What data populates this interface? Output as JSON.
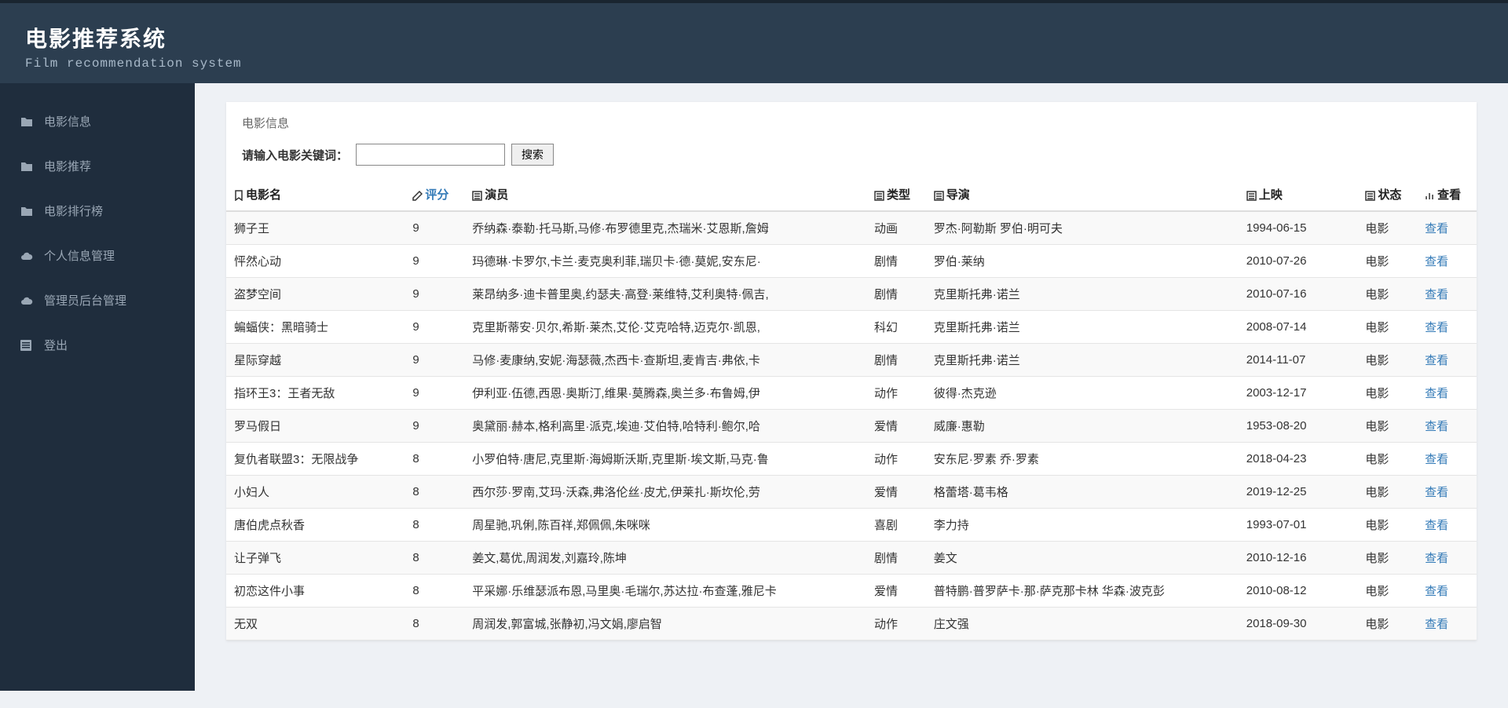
{
  "header": {
    "title": "电影推荐系统",
    "subtitle": "Film recommendation system"
  },
  "sidebar": {
    "items": [
      {
        "label": "电影信息",
        "icon": "folder"
      },
      {
        "label": "电影推荐",
        "icon": "folder"
      },
      {
        "label": "电影排行榜",
        "icon": "folder"
      },
      {
        "label": "个人信息管理",
        "icon": "cloud"
      },
      {
        "label": "管理员后台管理",
        "icon": "cloud"
      },
      {
        "label": "登出",
        "icon": "list"
      }
    ]
  },
  "panel": {
    "title": "电影信息"
  },
  "search": {
    "label": "请输入电影关键词：",
    "value": "",
    "button": "搜索"
  },
  "columns": {
    "name": "电影名",
    "score": "评分",
    "actor": "演员",
    "type": "类型",
    "director": "导演",
    "release": "上映",
    "status": "状态",
    "view": "查看"
  },
  "view_link_text": "查看",
  "rows": [
    {
      "name": "狮子王",
      "score": "9",
      "actor": "乔纳森·泰勒·托马斯,马修·布罗德里克,杰瑞米·艾恩斯,詹姆",
      "type": "动画",
      "director": "罗杰·阿勒斯 罗伯·明可夫",
      "release": "1994-06-15",
      "status": "电影"
    },
    {
      "name": "怦然心动",
      "score": "9",
      "actor": "玛德琳·卡罗尔,卡兰·麦克奥利菲,瑞贝卡·德·莫妮,安东尼·",
      "type": "剧情",
      "director": "罗伯·莱纳",
      "release": "2010-07-26",
      "status": "电影"
    },
    {
      "name": "盗梦空间",
      "score": "9",
      "actor": "莱昂纳多·迪卡普里奥,约瑟夫·高登·莱维特,艾利奥特·佩吉,",
      "type": "剧情",
      "director": "克里斯托弗·诺兰",
      "release": "2010-07-16",
      "status": "电影"
    },
    {
      "name": "蝙蝠侠：黑暗骑士",
      "score": "9",
      "actor": "克里斯蒂安·贝尔,希斯·莱杰,艾伦·艾克哈特,迈克尔·凯恩,",
      "type": "科幻",
      "director": "克里斯托弗·诺兰",
      "release": "2008-07-14",
      "status": "电影"
    },
    {
      "name": "星际穿越",
      "score": "9",
      "actor": "马修·麦康纳,安妮·海瑟薇,杰西卡·查斯坦,麦肯吉·弗依,卡",
      "type": "剧情",
      "director": "克里斯托弗·诺兰",
      "release": "2014-11-07",
      "status": "电影"
    },
    {
      "name": "指环王3：王者无敌",
      "score": "9",
      "actor": "伊利亚·伍德,西恩·奥斯汀,维果·莫腾森,奥兰多·布鲁姆,伊",
      "type": "动作",
      "director": "彼得·杰克逊",
      "release": "2003-12-17",
      "status": "电影"
    },
    {
      "name": "罗马假日",
      "score": "9",
      "actor": "奥黛丽·赫本,格利高里·派克,埃迪·艾伯特,哈特利·鲍尔,哈",
      "type": "爱情",
      "director": "威廉·惠勒",
      "release": "1953-08-20",
      "status": "电影"
    },
    {
      "name": "复仇者联盟3：无限战争",
      "score": "8",
      "actor": "小罗伯特·唐尼,克里斯·海姆斯沃斯,克里斯·埃文斯,马克·鲁",
      "type": "动作",
      "director": "安东尼·罗素 乔·罗素",
      "release": "2018-04-23",
      "status": "电影"
    },
    {
      "name": "小妇人",
      "score": "8",
      "actor": "西尔莎·罗南,艾玛·沃森,弗洛伦丝·皮尤,伊莱扎·斯坎伦,劳",
      "type": "爱情",
      "director": "格蕾塔·葛韦格",
      "release": "2019-12-25",
      "status": "电影"
    },
    {
      "name": "唐伯虎点秋香",
      "score": "8",
      "actor": "周星驰,巩俐,陈百祥,郑佩佩,朱咪咪",
      "type": "喜剧",
      "director": "李力持",
      "release": "1993-07-01",
      "status": "电影"
    },
    {
      "name": "让子弹飞",
      "score": "8",
      "actor": "姜文,葛优,周润发,刘嘉玲,陈坤",
      "type": "剧情",
      "director": "姜文",
      "release": "2010-12-16",
      "status": "电影"
    },
    {
      "name": "初恋这件小事",
      "score": "8",
      "actor": "平采娜·乐维瑟派布恩,马里奥·毛瑞尔,苏达拉·布查蓬,雅尼卡",
      "type": "爱情",
      "director": "普特鹏·普罗萨卡·那·萨克那卡林 华森·波克彭",
      "release": "2010-08-12",
      "status": "电影"
    },
    {
      "name": "无双",
      "score": "8",
      "actor": "周润发,郭富城,张静初,冯文娟,廖启智",
      "type": "动作",
      "director": "庄文强",
      "release": "2018-09-30",
      "status": "电影"
    }
  ]
}
